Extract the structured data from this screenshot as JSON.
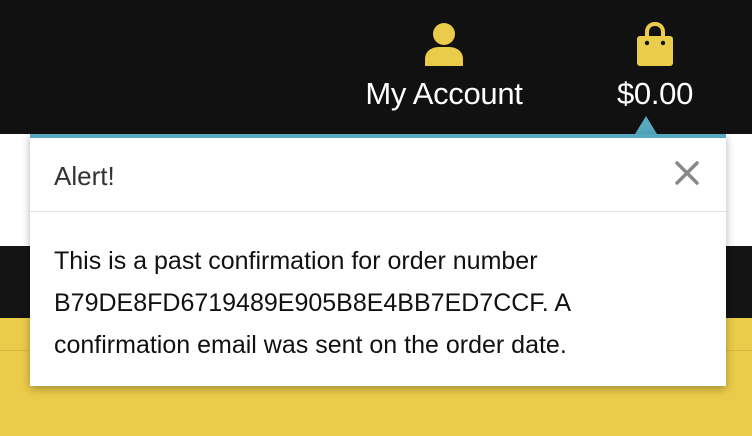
{
  "header": {
    "account_label": "My Account",
    "account_icon": "user-icon",
    "cart_label": "$0.00",
    "cart_icon": "shopping-bag-icon",
    "icon_color": "#ebcb4a"
  },
  "alert": {
    "title": "Alert!",
    "close_icon": "close-icon",
    "message_line1": "This is a past confirmation for order number",
    "message_line2": "B79DE8FD6719489E905B8E4BB7ED7CCF. A",
    "message_line3": "confirmation email was sent on the order date.",
    "accent_color": "#56a9bf"
  },
  "colors": {
    "topbar": "#111111",
    "gold": "#ebcb4a"
  }
}
